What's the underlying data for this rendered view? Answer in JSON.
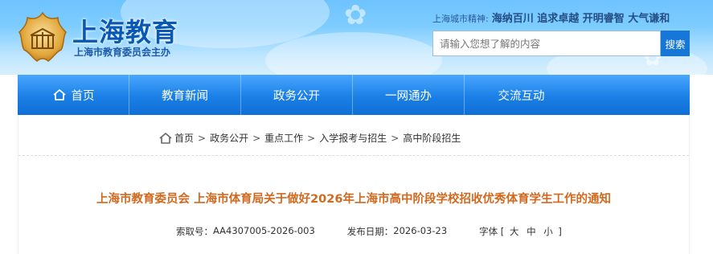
{
  "header": {
    "site_title": "上海教育",
    "site_subtitle": "上海市教育委员会主办",
    "motto_label": "上海城市精神:",
    "motto_text": "海纳百川 追求卓越 开明睿智 大气谦和",
    "search_placeholder": "请输入您想了解的内容",
    "search_button": "搜索"
  },
  "nav": {
    "items": [
      {
        "label": "首页",
        "icon": "home-icon"
      },
      {
        "label": "教育新闻"
      },
      {
        "label": "政务公开"
      },
      {
        "label": "一网通办"
      },
      {
        "label": "交流互动"
      }
    ]
  },
  "breadcrumb": {
    "icon": "home-icon",
    "items": [
      "首页",
      "政务公开",
      "重点工作",
      "入学报考与招生",
      "高中阶段招生"
    ],
    "separator": ">"
  },
  "article": {
    "title": "上海市教育委员会 上海市体育局关于做好2026年上海市高中阶段学校招收优秀体育学生工作的通知",
    "index_label": "索取号：",
    "index_value": "AA4307005-2026-003",
    "date_label": "发布日期：",
    "date_value": "2026-03-23",
    "font_label": "字体",
    "font_open": "[",
    "font_large": "大",
    "font_medium": "中",
    "font_small": "小",
    "font_close": "]"
  },
  "colors": {
    "nav_blue": "#1a7fe6",
    "title_orange": "#d2691e",
    "header_title_blue": "#0a58b5"
  }
}
